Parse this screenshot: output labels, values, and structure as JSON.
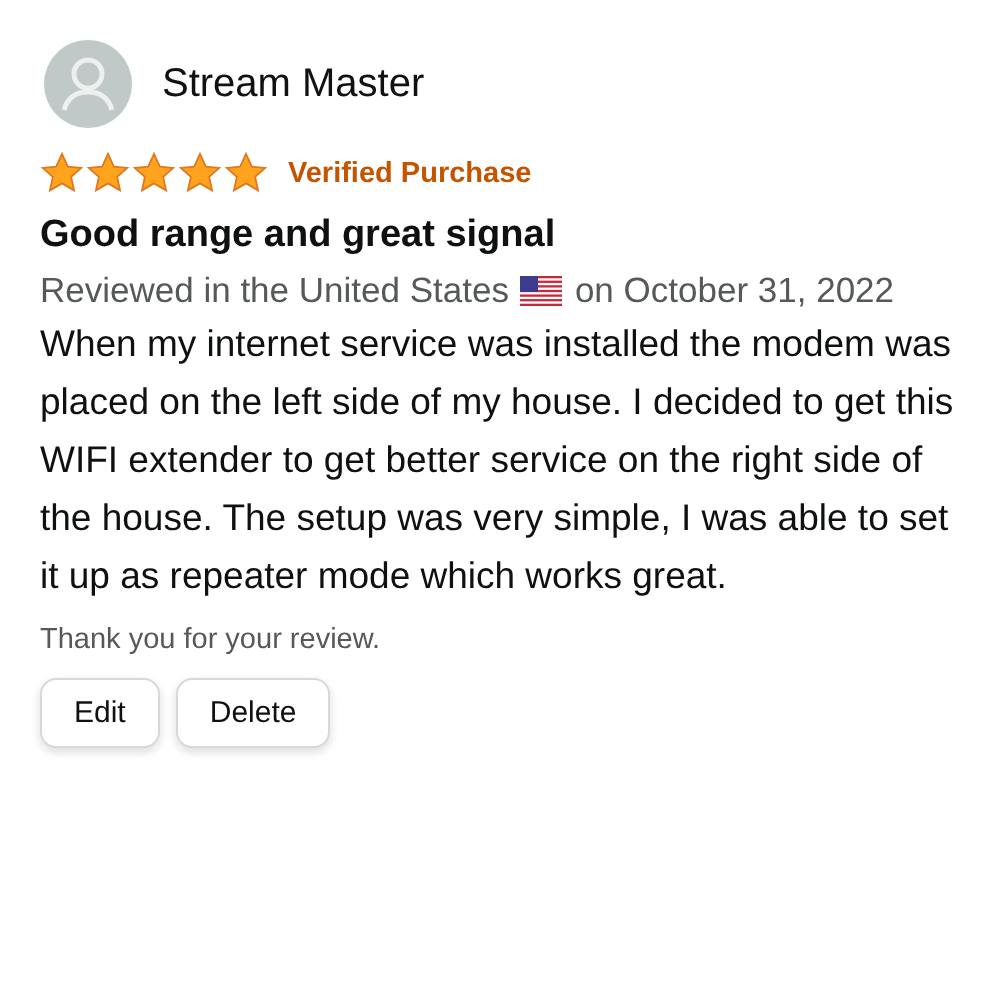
{
  "reviewer": {
    "name": "Stream Master"
  },
  "rating": {
    "stars": 5
  },
  "badge": "Verified Purchase",
  "title": "Good range and great signal",
  "meta": {
    "before_flag": "Reviewed in the United States",
    "after_flag": "on October 31, 2022"
  },
  "body": "When my internet service was installed the modem was placed on the left side of my house. I decided to get this WIFI extender to get better service on the right side of the house. The setup was very simple, I was able to set it up as repeater mode which works great.",
  "note": "Thank you for your review.",
  "buttons": [
    "Edit",
    "Delete"
  ]
}
